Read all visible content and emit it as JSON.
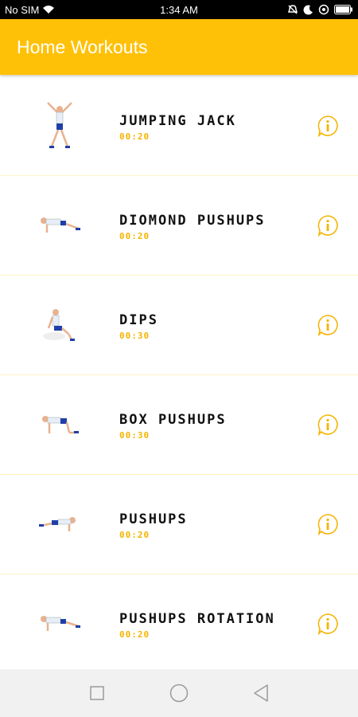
{
  "status_bar": {
    "carrier": "No SIM",
    "time": "1:34 AM",
    "icons": [
      "wifi-icon",
      "alarm-off-icon",
      "moon-icon",
      "battery-saver-icon",
      "battery-icon"
    ]
  },
  "app_bar": {
    "title": "Home Workouts"
  },
  "colors": {
    "accent": "#ffc107",
    "duration": "#f4b400",
    "divider": "#fff3c4"
  },
  "workouts": [
    {
      "name": "JUMPING JACK",
      "duration": "00:20",
      "figure": "jumping-jack-figure"
    },
    {
      "name": "DIOMOND PUSHUPS",
      "duration": "00:20",
      "figure": "pushup-figure"
    },
    {
      "name": "DIPS",
      "duration": "00:30",
      "figure": "dips-figure"
    },
    {
      "name": "BOX PUSHUPS",
      "duration": "00:30",
      "figure": "box-pushup-figure"
    },
    {
      "name": "PUSHUPS",
      "duration": "00:20",
      "figure": "pushup-figure"
    },
    {
      "name": "PUSHUPS ROTATION",
      "duration": "00:20",
      "figure": "pushup-rotation-figure"
    }
  ],
  "nav_bar": {
    "icons": [
      "recent-apps-icon",
      "home-icon",
      "back-icon"
    ]
  }
}
